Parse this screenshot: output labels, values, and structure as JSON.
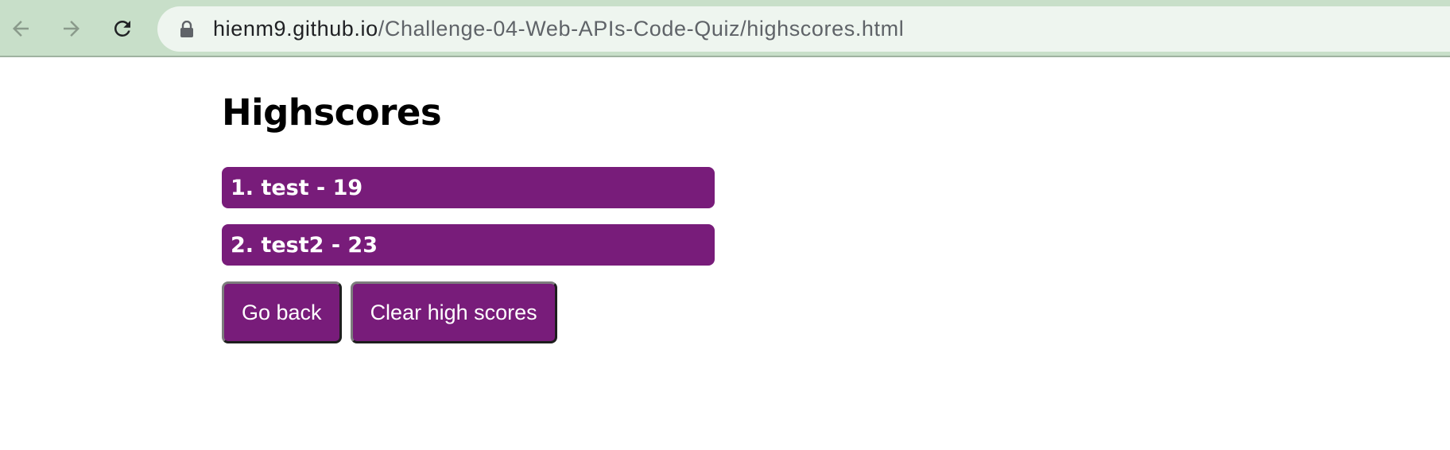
{
  "browser": {
    "url_host": "hienm9.github.io",
    "url_path": "/Challenge-04-Web-APIs-Code-Quiz/highscores.html",
    "icons": [
      "back-arrow-icon",
      "forward-arrow-icon",
      "reload-icon",
      "lock-icon"
    ]
  },
  "page": {
    "title": "Highscores",
    "scores": [
      {
        "text": "1. test - 19"
      },
      {
        "text": "2. test2 - 23"
      }
    ],
    "go_back_label": "Go back",
    "clear_label": "Clear high scores"
  },
  "colors": {
    "accent": "#781c7a",
    "browser_chrome": "#c8dfc9",
    "address_bar": "#eef5ef"
  }
}
